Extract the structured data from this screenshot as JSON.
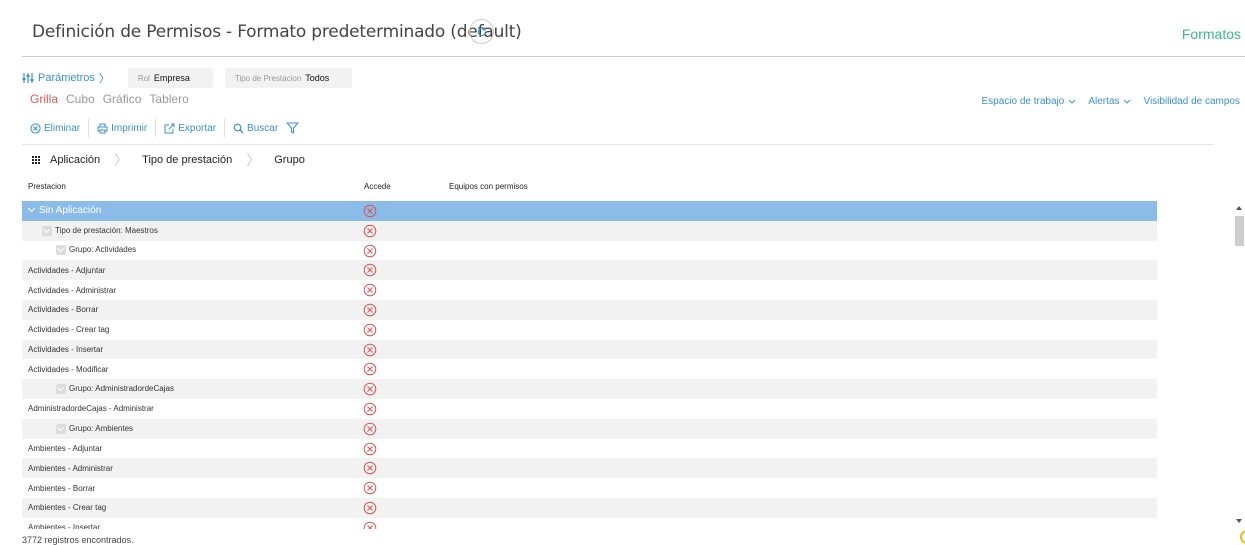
{
  "header": {
    "title": "Definición de Permisos - Formato predeterminado (default)",
    "formatos_label": "Formatos"
  },
  "params": {
    "label": "Parámetros",
    "rol_label": "Rol",
    "rol_value": "Empresa",
    "tipo_label": "Tipo de Prestacion",
    "tipo_value": "Todos"
  },
  "views": [
    "Grilla",
    "Cubo",
    "Gráfico",
    "Tablero"
  ],
  "right_links": {
    "workspace": "Espacio de trabajo",
    "alerts": "Alertas",
    "field_visibility": "Visibilidad de campos"
  },
  "toolbar": {
    "delete": "Eliminar",
    "print": "Imprimir",
    "export": "Exportar",
    "search": "Buscar"
  },
  "group_bar": [
    "Aplicación",
    "Tipo de prestación",
    "Grupo"
  ],
  "columns": {
    "prestacion": "Prestacion",
    "accede": "Accede",
    "equipos": "Equipos con permisos"
  },
  "rows": [
    {
      "label": "Sin Aplicación",
      "level": 0,
      "group": true
    },
    {
      "label": "Tipo de prestación: Maestros",
      "level": 1,
      "group": true
    },
    {
      "label": "Grupo: Actividades",
      "level": 2,
      "group": true
    },
    {
      "label": "Actividades - Adjuntar",
      "level": 3,
      "group": false
    },
    {
      "label": "Actividades - Administrar",
      "level": 3,
      "group": false
    },
    {
      "label": "Actividades - Borrar",
      "level": 3,
      "group": false
    },
    {
      "label": "Actividades - Crear tag",
      "level": 3,
      "group": false
    },
    {
      "label": "Actividades - Insertar",
      "level": 3,
      "group": false
    },
    {
      "label": "Actividades - Modificar",
      "level": 3,
      "group": false
    },
    {
      "label": "Grupo: AdministradordeCajas",
      "level": 2,
      "group": true
    },
    {
      "label": "AdministradordeCajas - Administrar",
      "level": 3,
      "group": false
    },
    {
      "label": "Grupo: Ambientes",
      "level": 2,
      "group": true
    },
    {
      "label": "Ambientes - Adjuntar",
      "level": 3,
      "group": false
    },
    {
      "label": "Ambientes - Administrar",
      "level": 3,
      "group": false
    },
    {
      "label": "Ambientes - Borrar",
      "level": 3,
      "group": false
    },
    {
      "label": "Ambientes - Crear tag",
      "level": 3,
      "group": false
    },
    {
      "label": "Ambientes - Insertar",
      "level": 3,
      "group": false
    }
  ],
  "footer": "3772 registros encontrados.",
  "colors": {
    "accent": "#3a8fd4",
    "active_tab": "#e05a5a",
    "formatos": "#3db88b",
    "selected_row": "#8bbbe8",
    "deny_icon": "#d9534f"
  }
}
